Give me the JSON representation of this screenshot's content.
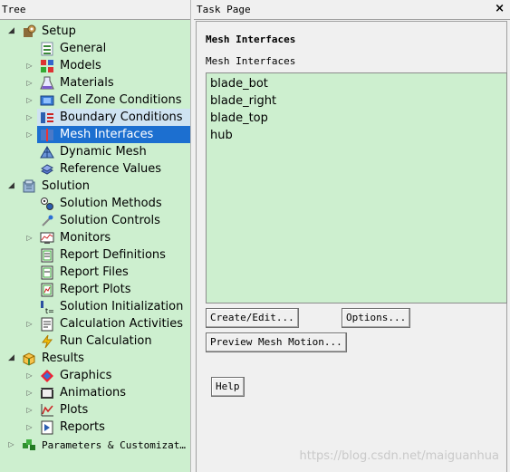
{
  "tree": {
    "title": "Tree",
    "items": [
      {
        "label": "Setup",
        "expander": "open",
        "level": 0,
        "icon": "setup-icon"
      },
      {
        "label": "General",
        "expander": "none",
        "level": 1,
        "icon": "general-icon"
      },
      {
        "label": "Models",
        "expander": "closed",
        "level": 1,
        "icon": "models-icon"
      },
      {
        "label": "Materials",
        "expander": "closed",
        "level": 1,
        "icon": "materials-icon"
      },
      {
        "label": "Cell Zone Conditions",
        "expander": "closed",
        "level": 1,
        "icon": "cell-zone-icon"
      },
      {
        "label": "Boundary Conditions",
        "expander": "closed",
        "level": 1,
        "icon": "boundary-conditions-icon",
        "state": "hover"
      },
      {
        "label": "Mesh Interfaces",
        "expander": "closed",
        "level": 1,
        "icon": "mesh-interfaces-icon",
        "state": "selected"
      },
      {
        "label": "Dynamic Mesh",
        "expander": "none",
        "level": 1,
        "icon": "dynamic-mesh-icon"
      },
      {
        "label": "Reference Values",
        "expander": "none",
        "level": 1,
        "icon": "reference-values-icon"
      },
      {
        "label": "Solution",
        "expander": "open",
        "level": 0,
        "icon": "solution-icon"
      },
      {
        "label": "Solution Methods",
        "expander": "none",
        "level": 1,
        "icon": "solution-methods-icon"
      },
      {
        "label": "Solution Controls",
        "expander": "none",
        "level": 1,
        "icon": "solution-controls-icon"
      },
      {
        "label": "Monitors",
        "expander": "closed",
        "level": 1,
        "icon": "monitors-icon"
      },
      {
        "label": "Report Definitions",
        "expander": "none",
        "level": 1,
        "icon": "report-definitions-icon"
      },
      {
        "label": "Report Files",
        "expander": "none",
        "level": 1,
        "icon": "report-files-icon"
      },
      {
        "label": "Report Plots",
        "expander": "none",
        "level": 1,
        "icon": "report-plots-icon"
      },
      {
        "label": "Solution Initialization",
        "expander": "none",
        "level": 1,
        "icon": "solution-initialization-icon"
      },
      {
        "label": "Calculation Activities",
        "expander": "closed",
        "level": 1,
        "icon": "calculation-activities-icon"
      },
      {
        "label": "Run Calculation",
        "expander": "none",
        "level": 1,
        "icon": "run-calculation-icon"
      },
      {
        "label": "Results",
        "expander": "open",
        "level": 0,
        "icon": "results-icon"
      },
      {
        "label": "Graphics",
        "expander": "closed",
        "level": 1,
        "icon": "graphics-icon"
      },
      {
        "label": "Animations",
        "expander": "closed",
        "level": 1,
        "icon": "animations-icon"
      },
      {
        "label": "Plots",
        "expander": "closed",
        "level": 1,
        "icon": "plots-icon"
      },
      {
        "label": "Reports",
        "expander": "closed",
        "level": 1,
        "icon": "reports-icon"
      },
      {
        "label": "Parameters & Customizat…",
        "expander": "closed",
        "level": 0,
        "icon": "parameters-icon",
        "mono": true
      }
    ]
  },
  "task": {
    "title": "Task Page",
    "close_icon": "×",
    "heading": "Mesh Interfaces",
    "list_label": "Mesh Interfaces",
    "interfaces": [
      "blade_bot",
      "blade_right",
      "blade_top",
      "hub"
    ],
    "buttons": {
      "create_edit": "Create/Edit...",
      "options": "Options...",
      "preview": "Preview Mesh Motion...",
      "help": "Help"
    }
  },
  "watermark": "https://blog.csdn.net/maiguanhua",
  "colors": {
    "tree_bg": "#cdefcf",
    "selected": "#1c6fd0",
    "hover": "#cfe3f2",
    "list_bg": "#cdefcf"
  }
}
